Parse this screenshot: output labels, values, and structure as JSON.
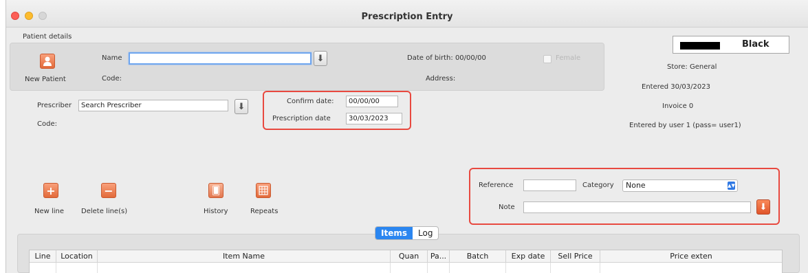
{
  "window": {
    "title": "Prescription Entry"
  },
  "patient": {
    "section_label": "Patient details",
    "new_patient_label": "New Patient",
    "name_label": "Name",
    "name_value": "",
    "code_label": "Code:",
    "dob_label": "Date of birth: 00/00/00",
    "female_label": "Female",
    "address_label": "Address:"
  },
  "prescriber": {
    "label": "Prescriber",
    "value": "Search Prescriber",
    "code_label": "Code:"
  },
  "dates": {
    "confirm_label": "Confirm date:",
    "confirm_value": "00/00/00",
    "prescription_label": "Prescription date",
    "prescription_value": "30/03/2023"
  },
  "status": {
    "color_name": "Black",
    "color_hex": "#000000",
    "store": "Store: General",
    "entered": "Entered 30/03/2023",
    "invoice": "Invoice 0",
    "entered_by": "Entered by user 1 (pass= user1)"
  },
  "toolbar": {
    "new_line": "New line",
    "delete_lines": "Delete line(s)",
    "history": "History",
    "repeats": "Repeats"
  },
  "reference": {
    "reference_label": "Reference",
    "reference_value": "",
    "category_label": "Category",
    "category_value": "None",
    "note_label": "Note",
    "note_value": ""
  },
  "tabs": [
    "Items",
    "Log"
  ],
  "table": {
    "columns": [
      "Line",
      "Location",
      "Item Name",
      "Quan",
      "Pa...",
      "Batch",
      "Exp date",
      "Sell Price",
      "Price exten"
    ]
  },
  "accent_colors": {
    "highlight_red": "#e8493f",
    "tab_blue": "#2b86f0",
    "icon_orange": "#e26a3a"
  }
}
